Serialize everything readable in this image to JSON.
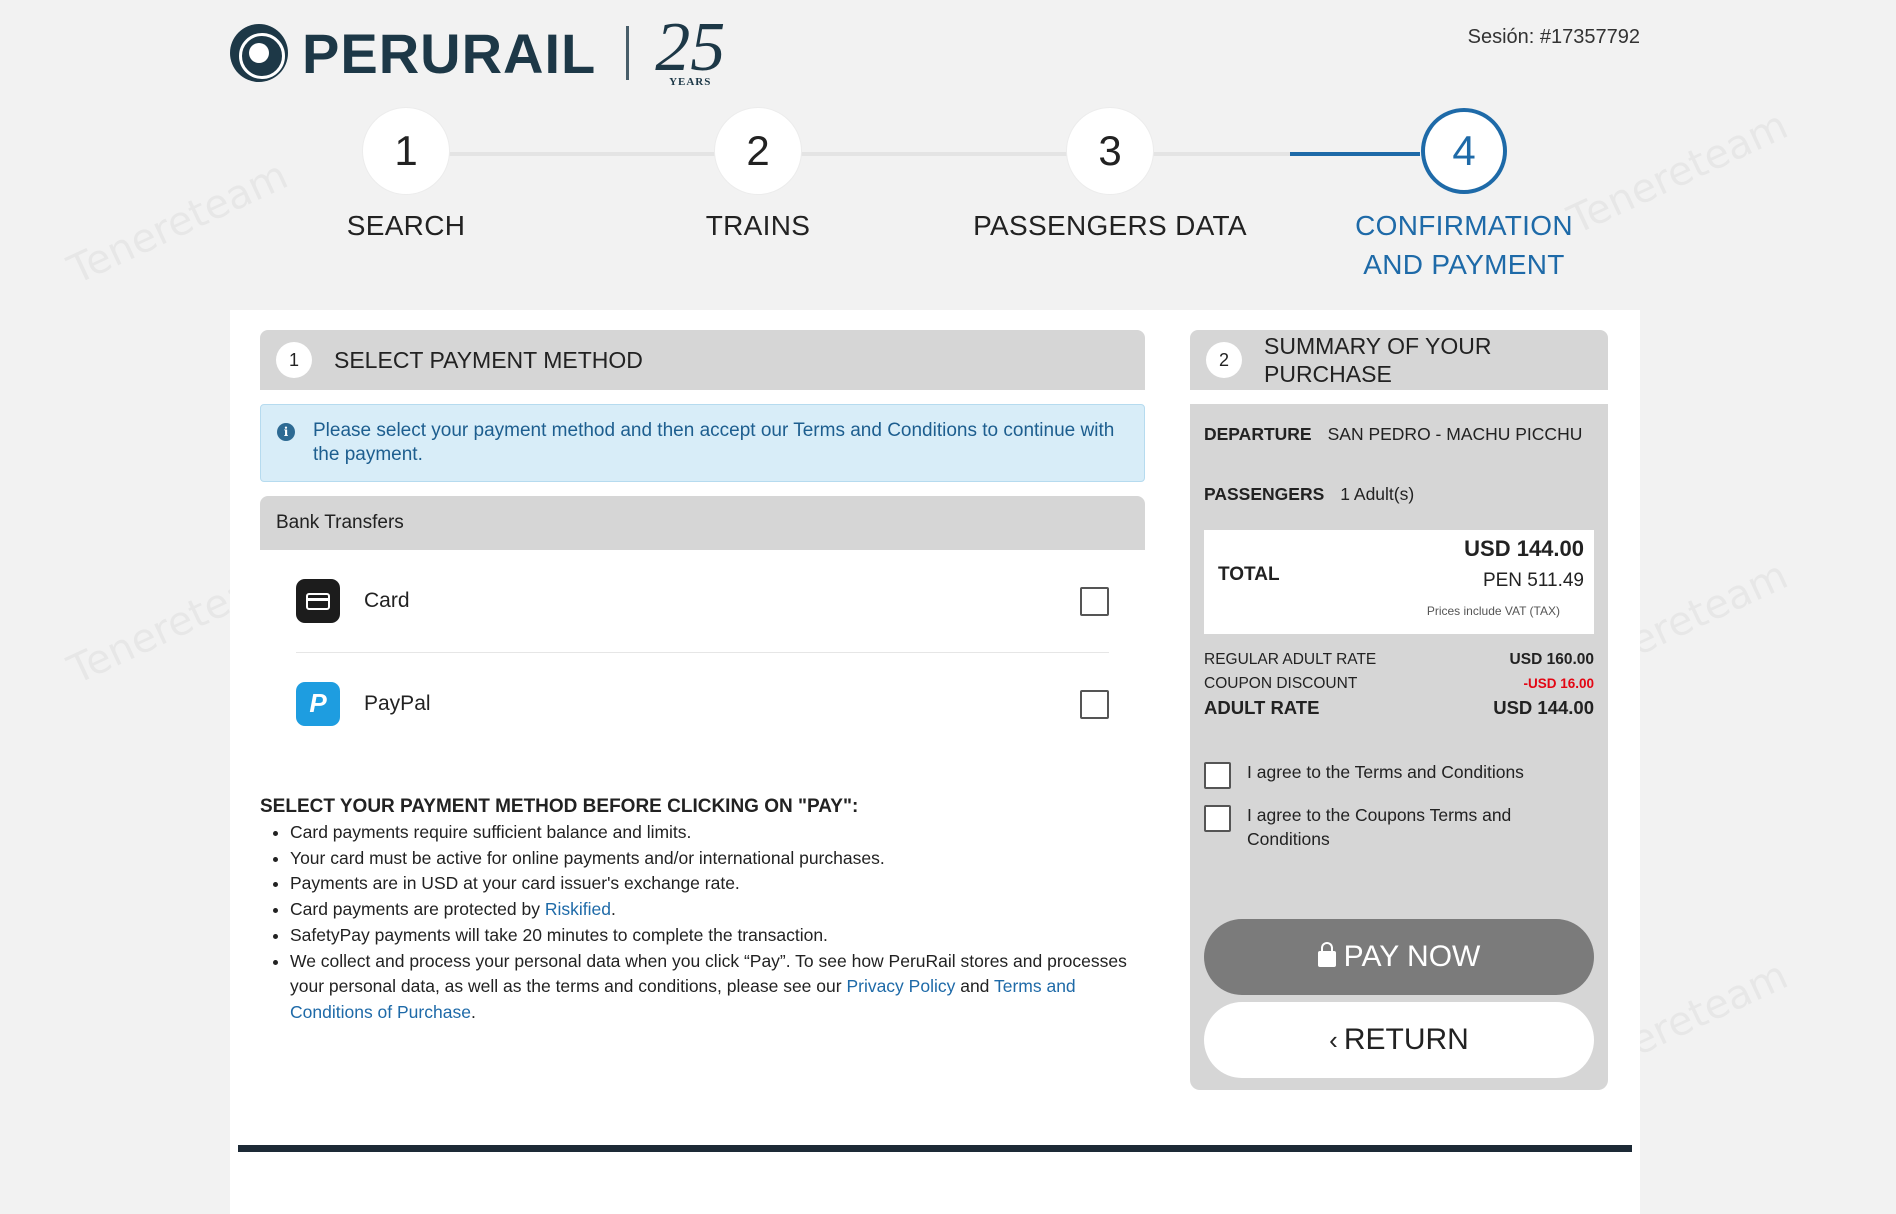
{
  "header": {
    "logo_text": "PERURAIL",
    "anniversary_number": "25",
    "anniversary_word": "YEARS",
    "session": "Sesión: #17357792"
  },
  "steps": [
    {
      "number": "1",
      "label": "SEARCH"
    },
    {
      "number": "2",
      "label": "TRAINS"
    },
    {
      "number": "3",
      "label": "PASSENGERS DATA"
    },
    {
      "number": "4",
      "label": "CONFIRMATION AND PAYMENT"
    }
  ],
  "payment": {
    "section_number": "1",
    "title": "SELECT PAYMENT METHOD",
    "info": "Please select your payment method and then accept our Terms and Conditions to continue with the payment.",
    "bank_transfers": "Bank Transfers",
    "methods": [
      {
        "label": "Card",
        "icon": "card-icon",
        "checked": false
      },
      {
        "label": "PayPal",
        "icon": "paypal-icon",
        "checked": false
      }
    ],
    "notes_title": "SELECT YOUR PAYMENT METHOD BEFORE CLICKING ON \"PAY\":",
    "notes": {
      "n1": "Card payments require sufficient balance and limits.",
      "n2": "Your card must be active for online payments and/or international purchases.",
      "n3": "Payments are in USD at your card issuer's exchange rate.",
      "n4_text": "Card payments are protected by ",
      "n4_link": "Riskified",
      "n5": "SafetyPay payments will take 20 minutes to complete the transaction.",
      "n6_text": "We collect and process your personal data when you click “Pay”. To see how PeruRail stores and processes your personal data, as well as the terms and conditions, please see our ",
      "n6_link1": "Privacy Policy",
      "n6_and": " and ",
      "n6_link2": "Terms and Conditions of Purchase"
    }
  },
  "summary": {
    "section_number": "2",
    "title": "SUMMARY OF YOUR PURCHASE",
    "departure_label": "DEPARTURE",
    "departure_value": "SAN PEDRO - MACHU PICCHU",
    "passengers_label": "PASSENGERS",
    "passengers_value": "1 Adult(s)",
    "total_label": "TOTAL",
    "total_usd": "USD 144.00",
    "total_pen": "PEN 511.49",
    "vat_note": "Prices include VAT (TAX)",
    "regular_label": "REGULAR ADULT RATE",
    "regular_value": "USD 160.00",
    "coupon_label": "COUPON DISCOUNT",
    "coupon_value": "-USD 16.00",
    "adult_label": "ADULT RATE",
    "adult_value": "USD 144.00",
    "agree_terms": "I agree to the Terms and Conditions",
    "agree_coupons": "I agree to the Coupons Terms and Conditions",
    "pay_button": "PAY NOW",
    "return_button": "RETURN"
  },
  "colors": {
    "primary": "#1e6aa8",
    "brand_dark": "#1d3847",
    "discount": "#e30613",
    "info_bg": "#d8edf8",
    "panel_grey": "#d6d6d6",
    "pay_button": "#7b7b7b"
  }
}
